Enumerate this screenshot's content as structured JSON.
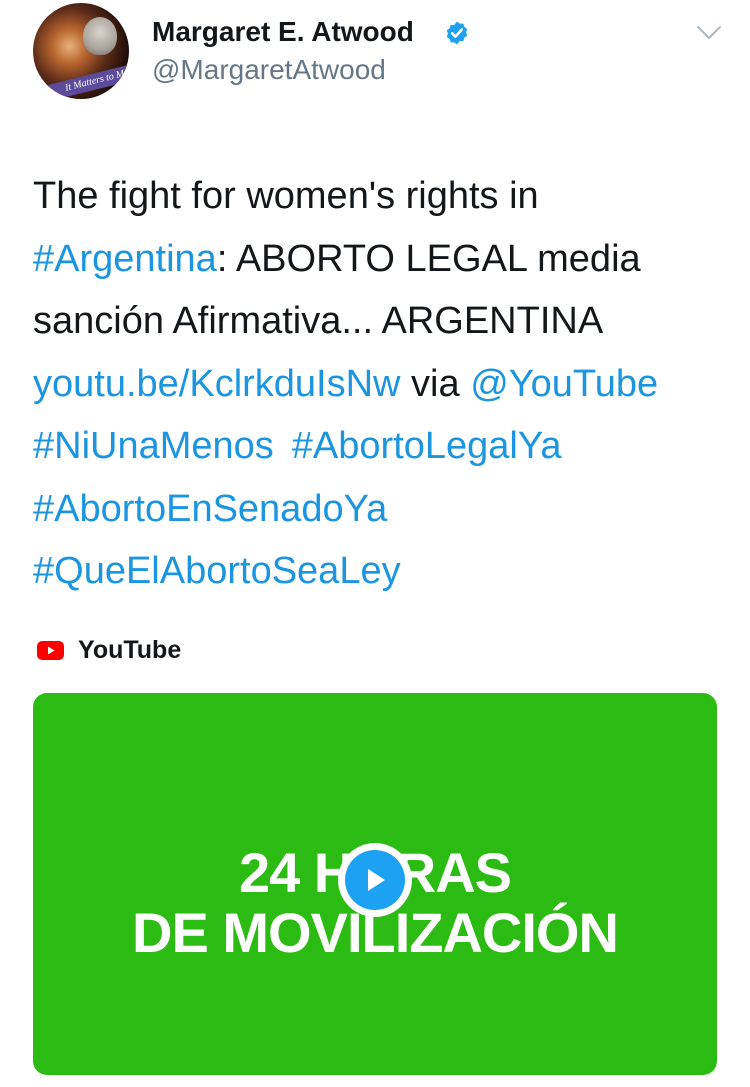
{
  "author": {
    "name": "Margaret E. Atwood",
    "handle": "@MargaretAtwood",
    "avatar_banner_text": "It Matters to Me"
  },
  "tweet": {
    "line1": "The fight for women's rights in",
    "hashtag_argentina": "#Argentina",
    "line2_rest": ": ABORTO LEGAL media",
    "line3": "sanción Afirmativa... ARGENTINA",
    "url": "youtu.be/KclrkduIsNw",
    "via": " via ",
    "mention": "@YouTube",
    "hashtag_niunamenos": "#NiUnaMenos",
    "hashtag_abortolegalya": "#AbortoLegalYa",
    "hashtag_abortoensenadoya": "#AbortoEnSenadoYa",
    "hashtag_queelabortosealey": "#QueElAbortoSeaLey"
  },
  "card": {
    "source_label": "YouTube",
    "video_title_line1": "24 HORAS",
    "video_title_line2": "DE MOVILIZACIÓN"
  },
  "icons": {
    "verified": "verified-badge-icon",
    "menu": "chevron-down-icon",
    "source": "youtube-logo-icon",
    "play": "play-icon"
  },
  "colors": {
    "link": "#1b95e0",
    "verified": "#1da1f2",
    "card_background": "#2cbb13",
    "youtube_red": "#ff0000"
  }
}
